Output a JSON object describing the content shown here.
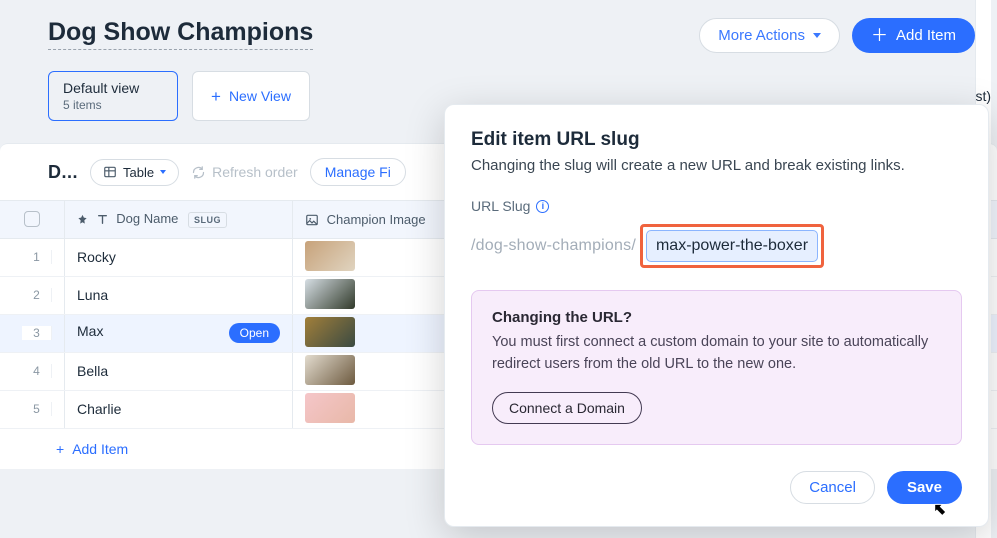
{
  "header": {
    "title": "Dog Show Champions",
    "more_actions": "More Actions",
    "add_item": "Add Item"
  },
  "views": {
    "default": {
      "name": "Default view",
      "subtitle": "5 items"
    },
    "new_view": "New View"
  },
  "toolbar": {
    "title_truncated": "D...",
    "view_mode": "Table",
    "refresh": "Refresh order",
    "manage_fields": "Manage Fi"
  },
  "columns": {
    "name": "Dog Name",
    "slug_badge": "SLUG",
    "image": "Champion Image"
  },
  "rows": [
    {
      "idx": "1",
      "name": "Rocky"
    },
    {
      "idx": "2",
      "name": "Luna"
    },
    {
      "idx": "3",
      "name": "Max",
      "open": "Open"
    },
    {
      "idx": "4",
      "name": "Bella"
    },
    {
      "idx": "5",
      "name": "Charlie"
    }
  ],
  "add_row": "Add Item",
  "side_fragment": "st)",
  "modal": {
    "title": "Edit item URL slug",
    "subtitle": "Changing the slug will create a new URL and break existing links.",
    "field_label": "URL Slug",
    "prefix": "/dog-show-champions/",
    "value": "max-power-the-boxer",
    "callout_title": "Changing the URL?",
    "callout_body": "You must first connect a custom domain to your site to automatically redirect users from the old URL to the new one.",
    "connect": "Connect a Domain",
    "cancel": "Cancel",
    "save": "Save"
  }
}
